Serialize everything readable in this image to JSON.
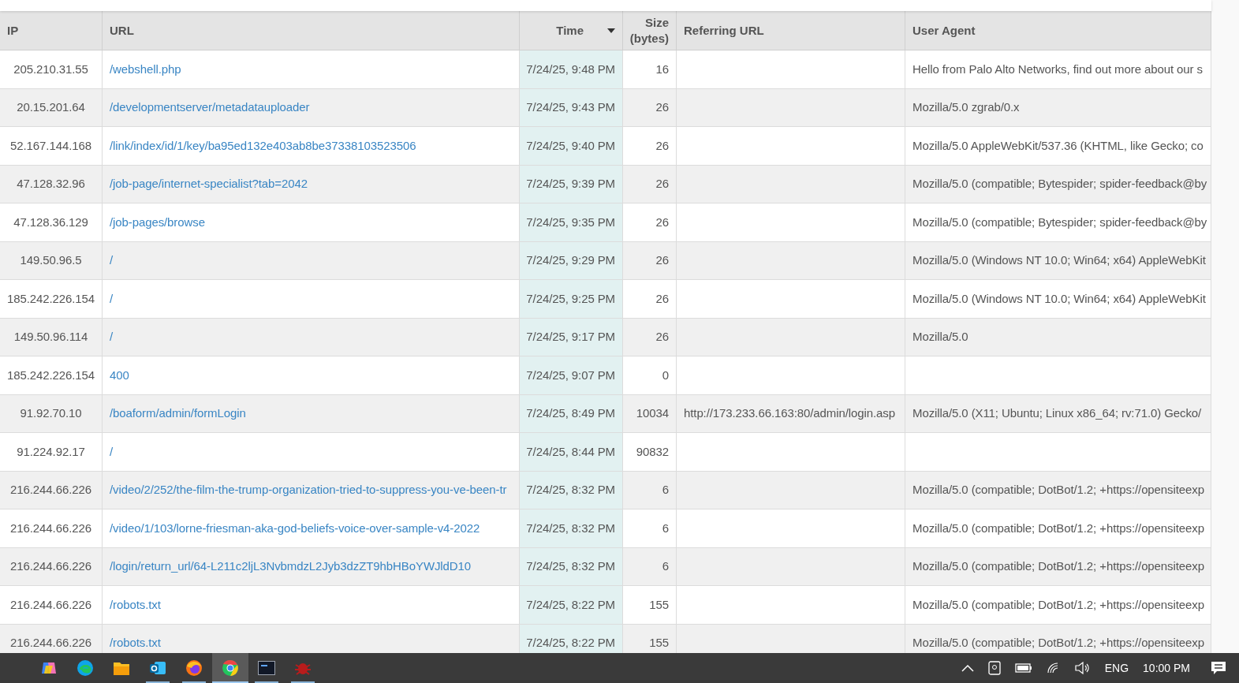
{
  "table": {
    "columns": [
      {
        "label": "IP",
        "sorted": false
      },
      {
        "label": "URL",
        "sorted": false
      },
      {
        "label": "Time",
        "sorted": true
      },
      {
        "label": "Size (bytes)",
        "sorted": false
      },
      {
        "label": "Referring URL",
        "sorted": false
      },
      {
        "label": "User Agent",
        "sorted": false
      }
    ],
    "rows": [
      {
        "ip": "205.210.31.55",
        "url": "/webshell.php",
        "time": "7/24/25, 9:48 PM",
        "size": "16",
        "user_agent": "Hello from Palo Alto Networks, find out more about our s"
      },
      {
        "ip": "20.15.201.64",
        "url": "/developmentserver/metadatauploader",
        "time": "7/24/25, 9:43 PM",
        "size": "26",
        "user_agent": "Mozilla/5.0 zgrab/0.x"
      },
      {
        "ip": "52.167.144.168",
        "url": "/link/index/id/1/key/ba95ed132e403ab8be37338103523506",
        "time": "7/24/25, 9:40 PM",
        "size": "26",
        "user_agent": "Mozilla/5.0 AppleWebKit/537.36 (KHTML, like Gecko; co"
      },
      {
        "ip": "47.128.32.96",
        "url": "/job-page/internet-specialist?tab=2042",
        "time": "7/24/25, 9:39 PM",
        "size": "26",
        "user_agent": "Mozilla/5.0 (compatible; Bytespider; spider-feedback@by"
      },
      {
        "ip": "47.128.36.129",
        "url": "/job-pages/browse",
        "time": "7/24/25, 9:35 PM",
        "size": "26",
        "user_agent": "Mozilla/5.0 (compatible; Bytespider; spider-feedback@by"
      },
      {
        "ip": "149.50.96.5",
        "url": "/",
        "time": "7/24/25, 9:29 PM",
        "size": "26",
        "user_agent": "Mozilla/5.0 (Windows NT 10.0; Win64; x64) AppleWebKit"
      },
      {
        "ip": "185.242.226.154",
        "url": "/",
        "time": "7/24/25, 9:25 PM",
        "size": "26",
        "user_agent": "Mozilla/5.0 (Windows NT 10.0; Win64; x64) AppleWebKit"
      },
      {
        "ip": "149.50.96.114",
        "url": "/",
        "time": "7/24/25, 9:17 PM",
        "size": "26",
        "user_agent": "Mozilla/5.0"
      },
      {
        "ip": "185.242.226.154",
        "url": "400",
        "time": "7/24/25, 9:07 PM",
        "size": "0"
      },
      {
        "ip": "91.92.70.10",
        "url": "/boaform/admin/formLogin",
        "time": "7/24/25, 8:49 PM",
        "size": "10034",
        "referrer": "http://173.233.66.163:80/admin/login.asp",
        "user_agent": "Mozilla/5.0 (X11; Ubuntu; Linux x86_64; rv:71.0) Gecko/"
      },
      {
        "ip": "91.224.92.17",
        "url": "/",
        "time": "7/24/25, 8:44 PM",
        "size": "90832"
      },
      {
        "ip": "216.244.66.226",
        "url": "/video/2/252/the-film-the-trump-organization-tried-to-suppress-you-ve-been-tr",
        "time": "7/24/25, 8:32 PM",
        "size": "6",
        "user_agent": "Mozilla/5.0 (compatible; DotBot/1.2; +https://opensiteexp"
      },
      {
        "ip": "216.244.66.226",
        "url": "/video/1/103/lorne-friesman-aka-god-beliefs-voice-over-sample-v4-2022",
        "time": "7/24/25, 8:32 PM",
        "size": "6",
        "user_agent": "Mozilla/5.0 (compatible; DotBot/1.2; +https://opensiteexp"
      },
      {
        "ip": "216.244.66.226",
        "url": "/login/return_url/64-L211c2ljL3NvbmdzL2Jyb3dzZT9hbHBoYWJldD10",
        "time": "7/24/25, 8:32 PM",
        "size": "6",
        "user_agent": "Mozilla/5.0 (compatible; DotBot/1.2; +https://opensiteexp"
      },
      {
        "ip": "216.244.66.226",
        "url": "/robots.txt",
        "time": "7/24/25, 8:22 PM",
        "size": "155",
        "user_agent": "Mozilla/5.0 (compatible; DotBot/1.2; +https://opensiteexp"
      },
      {
        "ip": "216.244.66.226",
        "url": "/robots.txt",
        "time": "7/24/25, 8:22 PM",
        "size": "155",
        "user_agent": "Mozilla/5.0 (compatible; DotBot/1.2; +https://opensiteexp"
      }
    ]
  },
  "taskbar": {
    "apps": [
      {
        "kind": "copilot",
        "selected": false,
        "running": false
      },
      {
        "kind": "edge",
        "selected": false,
        "running": false
      },
      {
        "kind": "folder",
        "selected": false,
        "running": false
      },
      {
        "kind": "mail",
        "selected": false,
        "running": true
      },
      {
        "kind": "firefox",
        "selected": false,
        "running": true
      },
      {
        "kind": "chrome",
        "selected": true,
        "running": true
      },
      {
        "kind": "terminal",
        "selected": false,
        "running": true
      },
      {
        "kind": "bug",
        "selected": false,
        "running": true
      }
    ],
    "tray": {
      "language": "ENG",
      "clock": "10:00 PM"
    }
  }
}
